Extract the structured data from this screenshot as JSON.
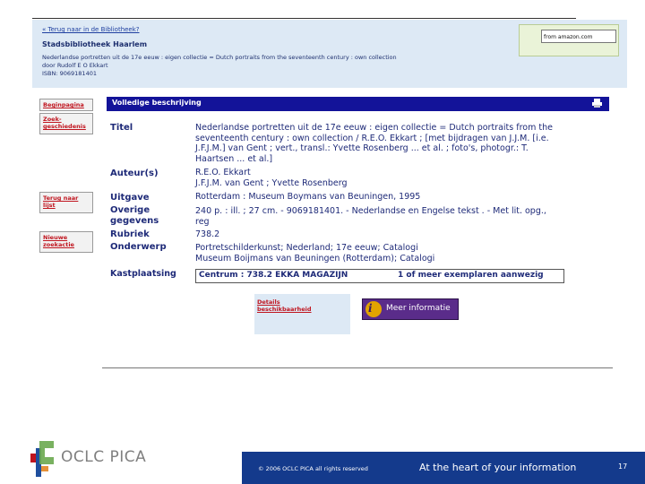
{
  "header": {
    "back_link": "« Terug naar in de Bibliotheek?",
    "library_name": "Stadsbibliotheek Haarlem",
    "book_lines": [
      "Nederlandse portretten uit de 17e eeuw : eigen collectie = Dutch portraits from the seventeenth century : own collection",
      "door Rudolf E O Ekkart",
      "ISBN: 9069181401"
    ],
    "amazon_label": "from amazon.com"
  },
  "sidebar": {
    "items": [
      {
        "label": "Beginpagina"
      },
      {
        "label": "Zoek-geschiedenis"
      },
      {
        "label": "Terug naar lijst"
      },
      {
        "label": "Nieuwe zoekactie"
      }
    ]
  },
  "record": {
    "section_title": "Volledige beschrijving",
    "fields": [
      {
        "label": "Titel",
        "lines": [
          "Nederlandse portretten uit de 17e eeuw : eigen collectie = Dutch portraits from the",
          "seventeenth century : own collection / R.E.O. Ekkart ; [met bijdragen van J.J.M. [i.e.",
          "J.F.J.M.] van Gent ; vert., transl.: Yvette Rosenberg ... et al. ; foto's, photogr.: T.",
          "Haartsen ... et al.]"
        ]
      },
      {
        "label": "Auteur(s)",
        "lines": [
          "R.E.O. Ekkart",
          "J.F.J.M. van Gent ; Yvette Rosenberg"
        ]
      },
      {
        "label": "Uitgave",
        "lines": [
          "Rotterdam : Museum Boymans van Beuningen, 1995"
        ]
      },
      {
        "label": "Overige gegevens",
        "lines": [
          "240 p. : ill. ; 27 cm. - 9069181401. - Nederlandse en Engelse tekst . - Met lit. opg.,",
          "reg"
        ]
      },
      {
        "label": "Rubriek",
        "lines": [
          "738.2"
        ]
      },
      {
        "label": "Onderwerp",
        "lines": [
          "Portretschilderkunst; Nederland; 17e eeuw; Catalogi",
          "Museum Boijmans van Beuningen (Rotterdam); Catalogi"
        ]
      },
      {
        "label": "Kastplaatsing",
        "lines": []
      }
    ],
    "location": "Centrum : 738.2 EKKA MAGAZIJN",
    "location_status": "1 of meer exemplaren aanwezig",
    "availability_link": "Details beschikbaarheid",
    "more_info_button": "Meer informatie"
  },
  "footer": {
    "brand": "OCLC PICA",
    "copyright": "© 2006 OCLC PICA all rights reserved",
    "tagline": "At the heart of your information",
    "page_number": "17"
  },
  "colors": {
    "banner": "#dde9f5",
    "header_bar": "#131399",
    "label_text": "#1e2a78",
    "nav_link": "#c0141e",
    "footer_bar": "#143a8c",
    "more_info": "#5a2c8a"
  }
}
